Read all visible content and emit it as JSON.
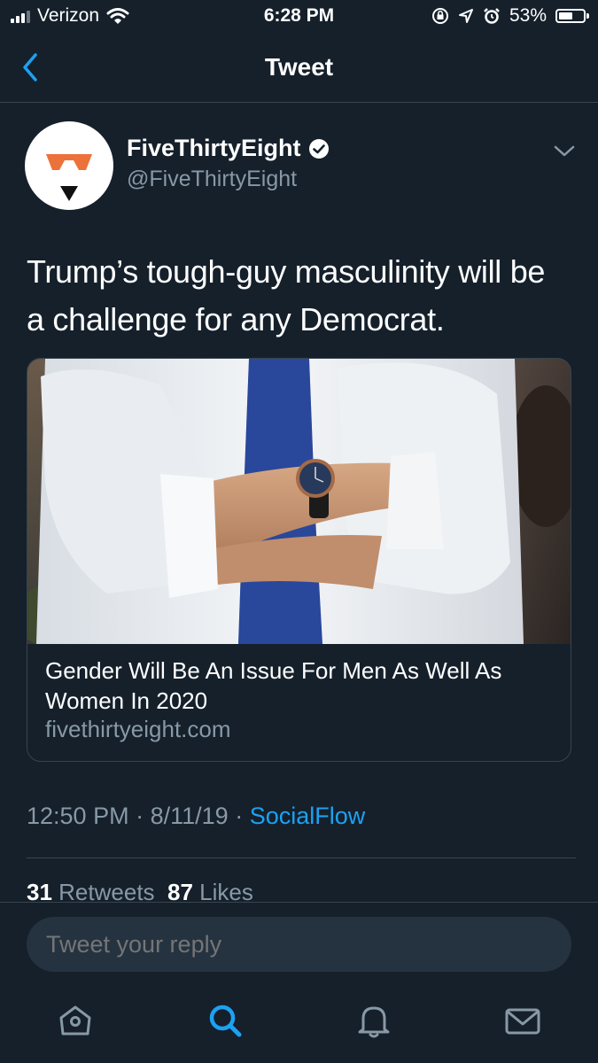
{
  "status_bar": {
    "carrier": "Verizon",
    "time": "6:28 PM",
    "battery": "53%"
  },
  "nav": {
    "title": "Tweet",
    "back_icon": "chevron-left-icon"
  },
  "tweet": {
    "author_name": "FiveThirtyEight",
    "author_handle": "@FiveThirtyEight",
    "verified": true,
    "text": "Trump’s tough-guy masculinity will be a challenge for any Democrat.",
    "card": {
      "title": "Gender Will Be An Issue For Men As Well As Women In 2020",
      "domain": "fivethirtyeight.com"
    },
    "time": "12:50 PM",
    "date": "8/11/19",
    "source": "SocialFlow",
    "retweets_count": "31",
    "retweets_label": "Retweets",
    "likes_count": "87",
    "likes_label": "Likes"
  },
  "reply": {
    "placeholder": "Tweet your reply"
  },
  "tabs": [
    {
      "icon": "home-icon"
    },
    {
      "icon": "search-icon"
    },
    {
      "icon": "bell-icon"
    },
    {
      "icon": "mail-icon"
    }
  ],
  "colors": {
    "background": "#15202b",
    "accent": "#1da1f2",
    "secondary_text": "#8899a6",
    "border": "#38444d",
    "logo_orange": "#ed713a"
  }
}
